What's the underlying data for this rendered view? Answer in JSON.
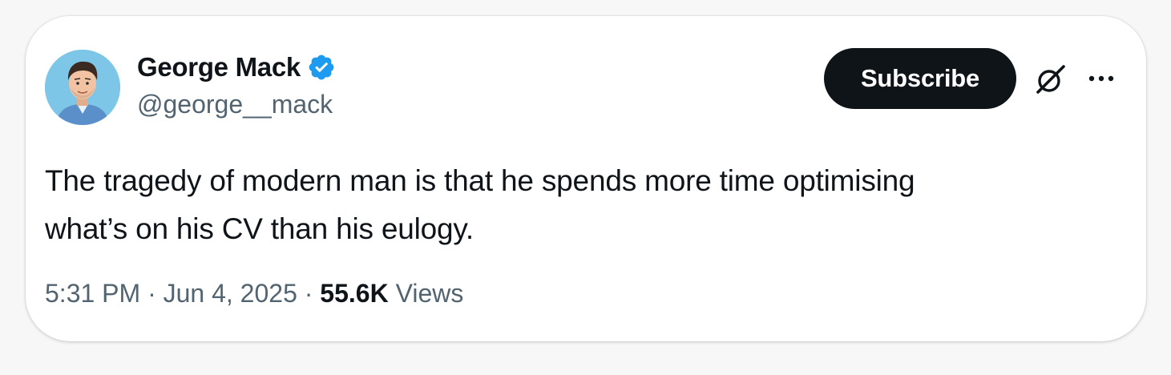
{
  "tweet": {
    "author": {
      "display_name": "George Mack",
      "handle": "@george__mack",
      "verified": true,
      "verified_badge_icon": "verified-badge-icon",
      "avatar_icon": "avatar-portrait"
    },
    "subscribe_label": "Subscribe",
    "grok_icon": "grok-icon",
    "more_icon": "more-options-icon",
    "text_line1": "The tragedy of modern man is that he spends more time optimising",
    "text_line2": "what’s on his CV than his eulogy.",
    "time": "5:31 PM",
    "separator": " · ",
    "date": "Jun 4, 2025",
    "views_count": "55.6K",
    "views_label": "Views"
  },
  "colors": {
    "accent_blue": "#1d9bf0",
    "text_primary": "#0f1419",
    "text_secondary": "#536471",
    "button_bg": "#0f1419",
    "card_bg": "#ffffff"
  }
}
